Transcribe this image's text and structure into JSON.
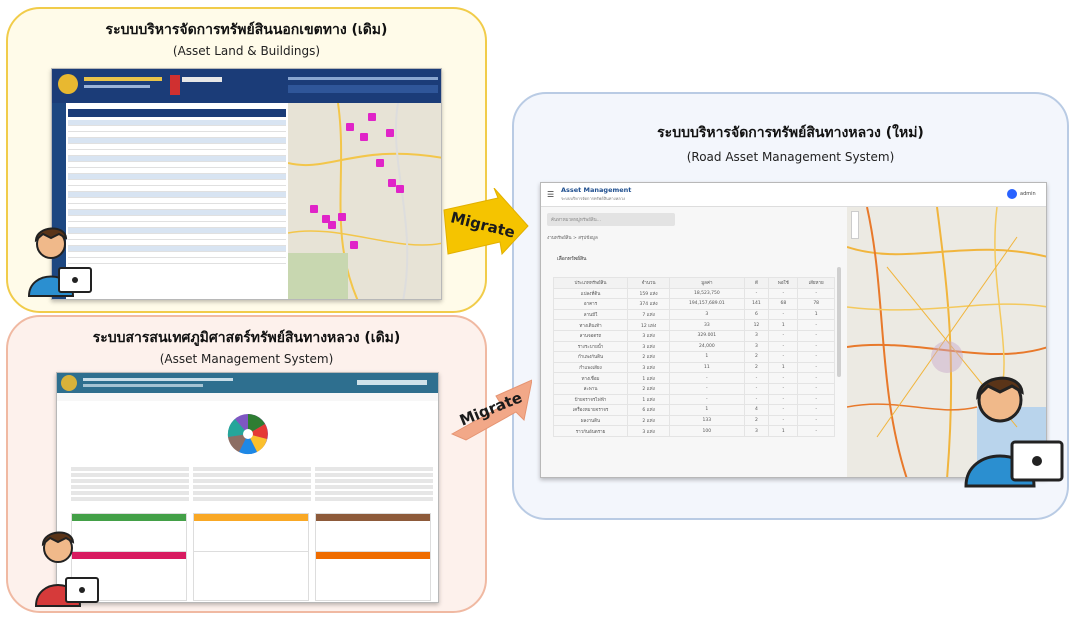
{
  "panels": {
    "old_land": {
      "title": "ระบบบริหารจัดการทรัพย์สินนอกเขตทาง (เดิม)",
      "subtitle": "(Asset Land & Buildings)"
    },
    "old_ams": {
      "title": "ระบบสารสนเทศภูมิศาสตร์ทรัพย์สินทางหลวง (เดิม)",
      "subtitle": "(Asset Management System)"
    },
    "new_rams": {
      "title": "ระบบบริหารจัดการทรัพย์สินทางหลวง (ใหม่)",
      "subtitle": "(Road Asset Management System)"
    }
  },
  "arrows": [
    {
      "label": "Migrate",
      "color": "#f5c400"
    },
    {
      "label": "Migrate",
      "color": "#f2a888"
    }
  ],
  "new_app": {
    "brand": "Asset Management",
    "brand_sub": "ระบบบริหารจัดการทรัพย์สินทางหลวง",
    "user": "admin",
    "search_placeholder": "ค้นหาหมวดหมู่ทรัพย์สิน...",
    "breadcrumb": "งานทรัพย์สิน > สรุปข้อมูล",
    "section": "เลือกทรัพย์สิน",
    "columns": [
      "ประเภททรัพย์สิน",
      "จำนวน",
      "มูลค่า",
      "ดี",
      "พอใช้",
      "เสียหาย"
    ],
    "rows": [
      [
        "แปลงที่ดิน",
        "159 แห่ง",
        "18,523,750",
        "-",
        "-",
        "-"
      ],
      [
        "อาคาร",
        "374 แห่ง",
        "194,157,689.01",
        "141",
        "68",
        "78"
      ],
      [
        "ลานมีใ",
        "7 แห่ง",
        "3",
        "6",
        "-",
        "1"
      ],
      [
        "ทางเดินเท้า",
        "12 แห่ง",
        "33",
        "12",
        "1",
        "-"
      ],
      [
        "ลานจอดรถ",
        "3 แห่ง",
        "329.001",
        "3",
        "-",
        "-"
      ],
      [
        "รางระบายน้ำ",
        "3 แห่ง",
        "24,000",
        "3",
        "-",
        "-"
      ],
      [
        "กำแพงกันดิน",
        "2 แห่ง",
        "1",
        "2",
        "-",
        "-"
      ],
      [
        "กำแพงเสียง",
        "3 แห่ง",
        "11",
        "2",
        "1",
        "-"
      ],
      [
        "ทางเชื่อม",
        "1 แห่ง",
        "-",
        "-",
        "-",
        "-"
      ],
      [
        "สะพาน",
        "2 แห่ง",
        "-",
        "-",
        "-",
        "-"
      ],
      [
        "ป้ายจราจรไฟฟ้า",
        "1 แห่ง",
        "-",
        "-",
        "-",
        "-"
      ],
      [
        "เครื่องหมายจราจร",
        "6 แห่ง",
        "1",
        "4",
        "-",
        "-"
      ],
      [
        "ผลงานดิน",
        "2 แห่ง",
        "133",
        "2",
        "-",
        "-"
      ],
      [
        "ราวกันอันตราย",
        "3 แห่ง",
        "100",
        "3",
        "1",
        "-"
      ]
    ]
  },
  "colors": {
    "yellow_border": "#f1cc4a",
    "peach_border": "#f0b9a2",
    "blue_border": "#b9cbe4",
    "header_navy": "#1b3c78",
    "ams_teal": "#2e6f8f"
  }
}
